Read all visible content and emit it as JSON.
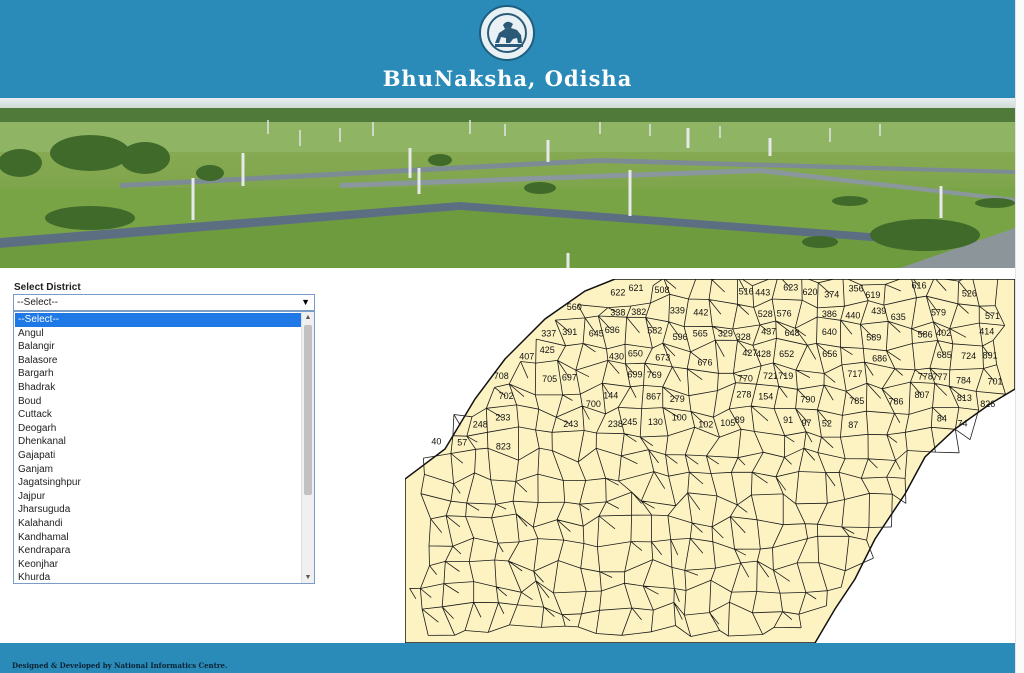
{
  "header": {
    "title": "BhuNaksha, Odisha"
  },
  "district": {
    "label": "Select District",
    "selected": "--Select--",
    "options": [
      "--Select--",
      "Angul",
      "Balangir",
      "Balasore",
      "Bargarh",
      "Bhadrak",
      "Boud",
      "Cuttack",
      "Deogarh",
      "Dhenkanal",
      "Gajapati",
      "Ganjam",
      "Jagatsinghpur",
      "Jajpur",
      "Jharsuguda",
      "Kalahandi",
      "Kandhamal",
      "Kendrapara",
      "Keonjhar",
      "Khurda"
    ]
  },
  "map": {
    "parcel_numbers": [
      "622",
      "621",
      "508",
      "516",
      "443",
      "623",
      "620",
      "374",
      "356",
      "619",
      "616",
      "526",
      "560",
      "338",
      "382",
      "339",
      "442",
      "528",
      "576",
      "386",
      "440",
      "439",
      "635",
      "579",
      "571",
      "337",
      "391",
      "645",
      "636",
      "582",
      "596",
      "565",
      "329",
      "328",
      "437",
      "648",
      "640",
      "589",
      "586",
      "402",
      "414",
      "407",
      "425",
      "430",
      "650",
      "673",
      "676",
      "427",
      "428",
      "652",
      "656",
      "686",
      "685",
      "724",
      "891",
      "708",
      "705",
      "697",
      "699",
      "769",
      "770",
      "721",
      "719",
      "717",
      "778",
      "777",
      "784",
      "701",
      "702",
      "700",
      "144",
      "867",
      "279",
      "278",
      "154",
      "790",
      "785",
      "786",
      "807",
      "813",
      "826",
      "248",
      "233",
      "243",
      "238",
      "245",
      "130",
      "100",
      "102",
      "105",
      "89",
      "91",
      "97",
      "52",
      "87",
      "84",
      "74",
      "40",
      "57",
      "823"
    ]
  },
  "footer": {
    "credit": "Designed & Developed by National Informatics Centre."
  },
  "colors": {
    "header_bg": "#2a8bb8",
    "map_fill": "#fdf3c2",
    "selected_option_bg": "#1e78e6"
  }
}
